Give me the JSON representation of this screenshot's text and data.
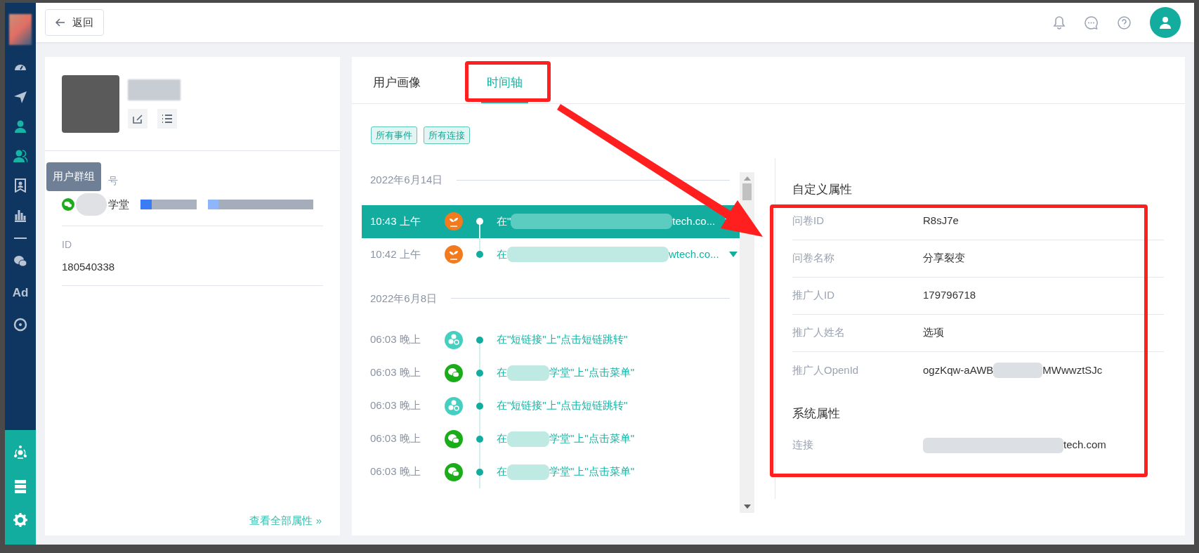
{
  "sidebar": {
    "items": [
      {
        "kind": "gauge",
        "active": false
      },
      {
        "kind": "send",
        "active": false
      },
      {
        "kind": "user",
        "active": true
      },
      {
        "kind": "users",
        "active": true
      },
      {
        "kind": "bookmark",
        "active": false
      },
      {
        "kind": "chart",
        "active": false
      },
      {
        "kind": "divider"
      },
      {
        "kind": "wechat",
        "active": false
      },
      {
        "kind": "text",
        "label": "Ad",
        "active": false
      },
      {
        "kind": "target",
        "active": false
      }
    ],
    "bottom_items": [
      {
        "kind": "network"
      },
      {
        "kind": "server"
      },
      {
        "kind": "gear"
      }
    ],
    "tooltip": "用户群组"
  },
  "topbar": {
    "back_button": "返回"
  },
  "profile": {
    "account_label": "号",
    "account_name_suffix": "学堂",
    "id_label": "ID",
    "id_value": "180540338",
    "view_all_link": "查看全部属性 »"
  },
  "tabs": [
    {
      "label": "用户画像",
      "selected": false
    },
    {
      "label": "时间轴",
      "selected": true
    }
  ],
  "filters": [
    {
      "label": "所有事件"
    },
    {
      "label": "所有连接"
    }
  ],
  "timeline": [
    {
      "date": "2022年6月14日",
      "events": [
        {
          "time": "10:43 上午",
          "kind": "plant",
          "parts": [
            "在\"",
            "tech.co..."
          ],
          "caret": true,
          "selected": true
        },
        {
          "time": "10:42 上午",
          "kind": "plant",
          "parts": [
            "在",
            "wtech.co..."
          ],
          "caret": true,
          "selected": false
        }
      ]
    },
    {
      "date": "2022年6月8日",
      "events": [
        {
          "time": "06:03 晚上",
          "kind": "shortlink",
          "parts": [
            "在\"短链接\"上\"点击短链跳转\""
          ],
          "caret": false,
          "selected": false
        },
        {
          "time": "06:03 晚上",
          "kind": "wechat",
          "parts": [
            "在",
            "学堂\"上\"点击菜单\""
          ],
          "caret": false,
          "selected": false
        },
        {
          "time": "06:03 晚上",
          "kind": "shortlink",
          "parts": [
            "在\"短链接\"上\"点击短链跳转\""
          ],
          "caret": false,
          "selected": false
        },
        {
          "time": "06:03 晚上",
          "kind": "wechat",
          "parts": [
            "在",
            "学堂\"上\"点击菜单\""
          ],
          "caret": false,
          "selected": false
        },
        {
          "time": "06:03 晚上",
          "kind": "wechat",
          "parts": [
            "在",
            "学堂\"上\"点击菜单\""
          ],
          "caret": false,
          "selected": false
        }
      ]
    }
  ],
  "custom_properties": {
    "title": "自定义属性",
    "rows": [
      {
        "label": "问卷ID",
        "parts": [
          "R8sJ7e"
        ]
      },
      {
        "label": "问卷名称",
        "parts": [
          "分享裂变"
        ]
      },
      {
        "label": "推广人ID",
        "parts": [
          "179796718"
        ]
      },
      {
        "label": "推广人姓名",
        "parts": [
          "选项"
        ]
      },
      {
        "label": "推广人OpenId",
        "parts": [
          "ogzKqw-aAWB",
          "MWwwztSJc"
        ]
      }
    ]
  },
  "system_properties": {
    "title": "系统属性",
    "rows": [
      {
        "label": "连接",
        "redacted_prefix": true,
        "parts": [
          "tech.com"
        ]
      }
    ]
  }
}
